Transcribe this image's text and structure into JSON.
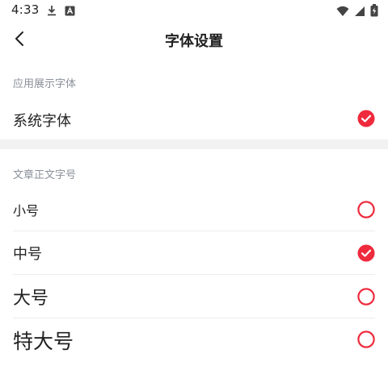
{
  "status_bar": {
    "time": "4:33",
    "left_icons": [
      "download-icon",
      "font-app-icon"
    ],
    "right_icons": [
      "wifi-icon",
      "signal-icon",
      "battery-charging-icon"
    ]
  },
  "top_bar": {
    "title": "字体设置",
    "back_icon": "chevron-left-icon"
  },
  "app_font_section": {
    "header": "应用展示字体",
    "options": [
      {
        "label": "系统字体",
        "selected": true
      }
    ]
  },
  "article_font_size_section": {
    "header": "文章正文字号",
    "options": [
      {
        "label": "小号",
        "selected": false
      },
      {
        "label": "中号",
        "selected": true
      },
      {
        "label": "大号",
        "selected": false
      },
      {
        "label": "特大号",
        "selected": false
      }
    ]
  },
  "colors": {
    "accent": "#ee2a3c",
    "section_header": "#8a8f99",
    "separator": "#f2f2f2",
    "divider": "#ececec"
  }
}
